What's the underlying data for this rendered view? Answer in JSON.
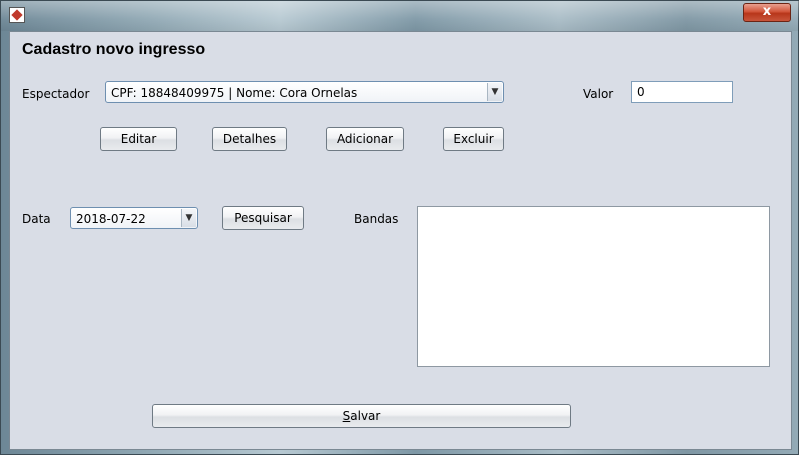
{
  "window": {
    "close_symbol": "x"
  },
  "form": {
    "title": "Cadastro novo ingresso",
    "espectador_label": "Espectador",
    "espectador_selected": "CPF: 18848409975 | Nome: Cora Ornelas",
    "valor_label": "Valor",
    "valor_value": "0",
    "buttons": {
      "editar": "Editar",
      "detalhes": "Detalhes",
      "adicionar": "Adicionar",
      "excluir": "Excluir",
      "pesquisar": "Pesquisar",
      "salvar_mnemonic": "S",
      "salvar_rest": "alvar"
    },
    "data_label": "Data",
    "data_selected": "2018-07-22",
    "bandas_label": "Bandas"
  },
  "icons": {
    "app": "app-icon",
    "dropdown": "chevron-down-icon"
  }
}
